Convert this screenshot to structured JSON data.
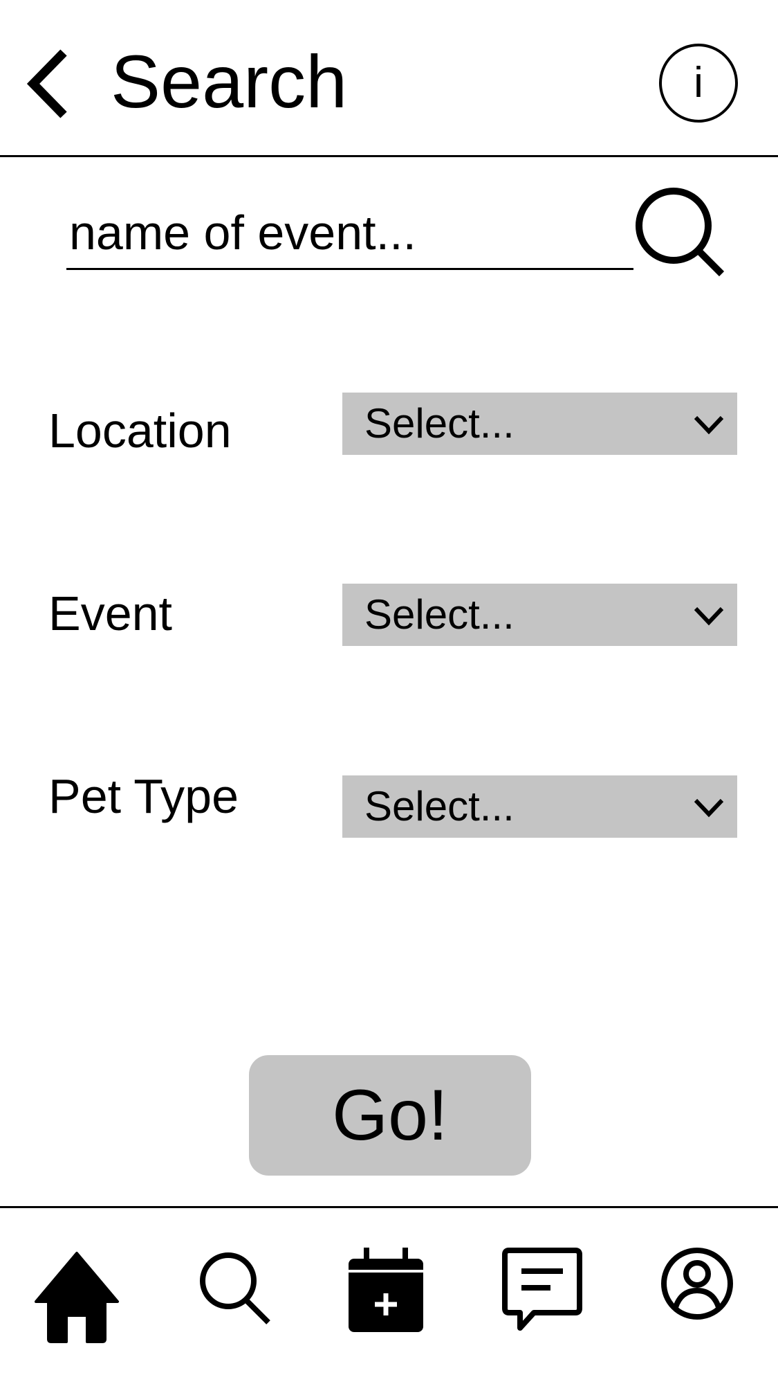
{
  "header": {
    "title": "Search",
    "back_icon": "chevron-left-icon",
    "info_icon": "info-icon"
  },
  "search": {
    "placeholder": "name of event...",
    "icon": "search-icon"
  },
  "filters": [
    {
      "label": "Location",
      "value": "Select..."
    },
    {
      "label": "Event",
      "value": "Select..."
    },
    {
      "label": "Pet Type",
      "value": "Select..."
    }
  ],
  "go_button": {
    "label": "Go!"
  },
  "bottom_nav": [
    {
      "icon": "home-icon"
    },
    {
      "icon": "search-icon"
    },
    {
      "icon": "calendar-add-icon"
    },
    {
      "icon": "chat-icon"
    },
    {
      "icon": "profile-icon"
    }
  ],
  "colors": {
    "control_background": "#c4c4c4",
    "foreground": "#000000",
    "background": "#ffffff"
  }
}
